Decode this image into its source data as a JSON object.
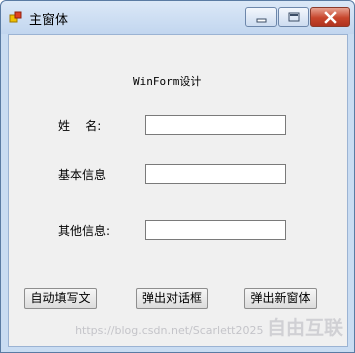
{
  "window": {
    "title": "主窗体"
  },
  "form": {
    "header": "WinForm设计",
    "fields": [
      {
        "label": "姓    名:",
        "value": ""
      },
      {
        "label": "基本信息",
        "value": ""
      },
      {
        "label": "其他信息:",
        "value": ""
      }
    ]
  },
  "buttons": {
    "autofill": "自动填写文",
    "dialog": "弹出对话框",
    "new_window": "弹出新窗体"
  },
  "watermark": {
    "text": "https://blog.csdn.net/Scarlett2025",
    "brand": "自由互联"
  }
}
